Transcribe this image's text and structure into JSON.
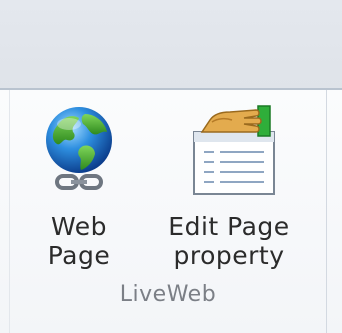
{
  "group": {
    "label": "LiveWeb",
    "buttons": [
      {
        "label_line1": "Web",
        "label_line2": "Page",
        "icon": "globe-link-icon"
      },
      {
        "label_line1": "Edit Page",
        "label_line2": "property",
        "icon": "hand-document-icon"
      }
    ]
  },
  "colors": {
    "ribbon_top": "#e1e5eb",
    "ribbon_body": "#f7f8fa",
    "label_text": "#2b2b2b",
    "group_label_text": "#7b7f86"
  }
}
